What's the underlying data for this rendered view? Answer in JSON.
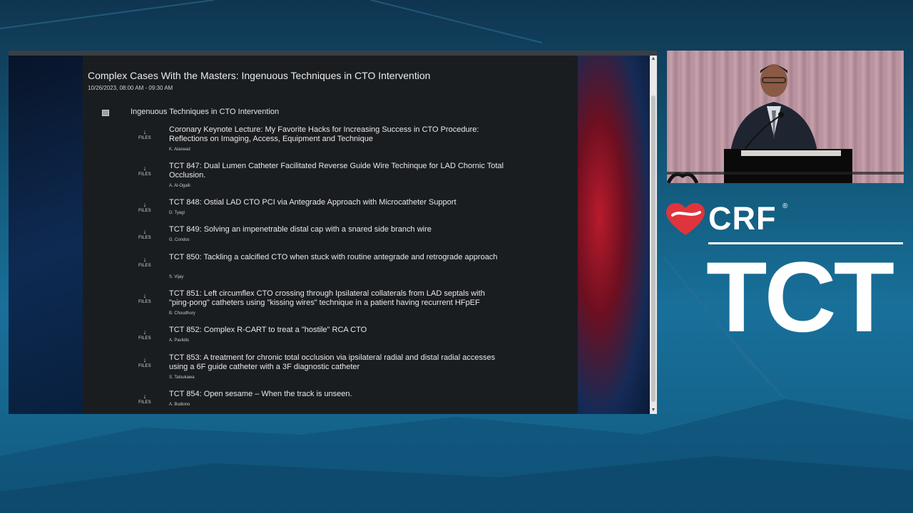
{
  "session": {
    "title": "Complex Cases With the Masters: Ingenuous Techniques in CTO Intervention",
    "datetime": "10/26/2023, 08:00 AM - 09:30 AM",
    "section_title": "Ingenuous Techniques in CTO Intervention",
    "files_label": "FILES",
    "files_icon": "download-arrow-icon",
    "items": [
      {
        "title": "Coronary Keynote Lecture: My Favorite Hacks for Increasing Success in CTO Procedure: Reflections on Imaging, Access, Equipment and Technique",
        "author": "K. Alaswad"
      },
      {
        "title": "TCT 847: Dual Lumen Catheter Facilitated Reverse Guide Wire Techinque for LAD Chornic Total Occlusion.",
        "author": "A. Al-Ogaili"
      },
      {
        "title": "TCT 848: Ostial LAD CTO PCI via Antegrade Approach with Microcatheter Support",
        "author": "D. Tyagi"
      },
      {
        "title": "TCT 849: Solving an impenetrable distal cap with a snared side branch wire",
        "author": "G. Condos"
      },
      {
        "title": "TCT 850: Tackling a calcified CTO when stuck with routine antegrade and retrograde approach",
        "author": "S. Vijay"
      },
      {
        "title": "TCT 851: Left circumflex CTO crossing through Ipsilateral collaterals from LAD septals with \"ping-pong\" catheters using \"kissing wires\" technique in a patient having recurrent HFpEF",
        "author": "B. Choudhury"
      },
      {
        "title": "TCT 852: Complex R-CART to treat a \"hostile\" RCA CTO",
        "author": "A. Pavlidis"
      },
      {
        "title": "TCT 853: A treatment for chronic total occlusion via ipsilateral radial and distal radial accesses using a 6F guide catheter with a 3F diagnostic catheter",
        "author": "S. Tatsukawa"
      },
      {
        "title": "TCT 854: Open sesame – When the track is unseen.",
        "author": "A. Budiono"
      }
    ]
  },
  "branding": {
    "crf": "CRF",
    "registered": "®",
    "tct": "TCT",
    "heart_color": "#e0343c"
  }
}
